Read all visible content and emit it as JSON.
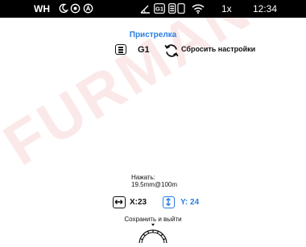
{
  "status_bar": {
    "white_hot_mode": "WH",
    "icons": [
      "moon-icon",
      "brightness-icon",
      "auto-mode-icon",
      "angle-icon",
      "profile-g1-icon",
      "memory-icon",
      "wifi-icon"
    ],
    "zoom": "1x",
    "time": "12:34"
  },
  "watermark": "FURMAN",
  "screen": {
    "title": "Пристрелка",
    "profile_name": "G1",
    "reset_label": "Сбросить настройки"
  },
  "zeroing": {
    "press_label": "Нажать:",
    "step_value": "19.5mm@100m",
    "x_label": "X:23",
    "y_label": "Y: 24"
  },
  "footer": {
    "save_exit_label": "Сохранить и выйти"
  },
  "colors": {
    "accent": "#2a7de1",
    "status_bar_bg": "#000000",
    "background": "#ffffff"
  }
}
